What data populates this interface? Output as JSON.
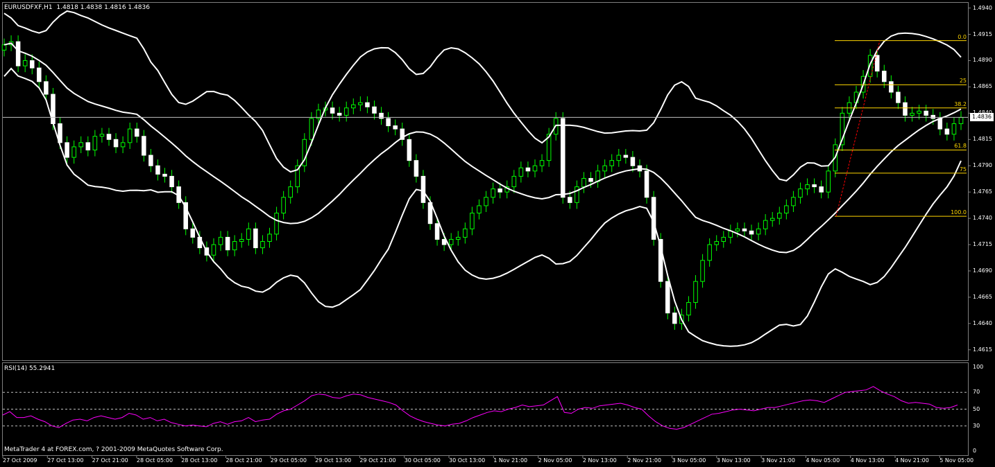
{
  "chart_header": {
    "symbol": "EURUSDFXF,H1",
    "ohlc": "1.4818 1.4838 1.4816 1.4836"
  },
  "copyright": "MetaTrader 4 at FOREX.com, ? 2001-2009 MetaQuotes Software Corp.",
  "current_price": "1.4836",
  "rsi_caption": "RSI(14) 55.2941",
  "colors": {
    "background": "#000000",
    "bull_candle": "#ffffff",
    "bear_candle": "#ffffff",
    "wick": "#00ff00",
    "bollinger": "#ffffff",
    "fib_levels": "#ffd700",
    "fib_trend": "#ff0000",
    "rsi": "#ff00ff",
    "grid_frame": "#808080"
  },
  "fibonacci": {
    "levels": [
      {
        "label": "0.0",
        "price": 1.4909
      },
      {
        "label": "25",
        "price": 1.4867
      },
      {
        "label": "38.2",
        "price": 1.4845
      },
      {
        "label": "61.8",
        "price": 1.4805
      },
      {
        "label": "75",
        "price": 1.4783
      },
      {
        "label": "100.0",
        "price": 1.4742
      }
    ]
  },
  "chart_data": {
    "type": "line",
    "title": "EURUSDFXF,H1",
    "price_axis": {
      "ticks": [
        "1.4940",
        "1.4915",
        "1.4890",
        "1.4865",
        "1.4840",
        "1.4815",
        "1.4790",
        "1.4765",
        "1.4740",
        "1.4715",
        "1.4690",
        "1.4665",
        "1.4640",
        "1.4615"
      ],
      "ylim": [
        1.4605,
        1.4945
      ]
    },
    "time_axis": {
      "ticks": [
        "27 Oct 2009",
        "27 Oct 13:00",
        "27 Oct 21:00",
        "28 Oct 05:00",
        "28 Oct 13:00",
        "28 Oct 21:00",
        "29 Oct 05:00",
        "29 Oct 13:00",
        "29 Oct 21:00",
        "30 Oct 05:00",
        "30 Oct 13:00",
        "1 Nov 21:00",
        "2 Nov 05:00",
        "2 Nov 13:00",
        "2 Nov 21:00",
        "3 Nov 05:00",
        "3 Nov 13:00",
        "3 Nov 21:00",
        "4 Nov 05:00",
        "4 Nov 13:00",
        "4 Nov 21:00",
        "5 Nov 05:00"
      ]
    },
    "close_prices": [
      1.4905,
      1.4908,
      1.4885,
      1.489,
      1.4883,
      1.487,
      1.4858,
      1.483,
      1.4812,
      1.4798,
      1.4808,
      1.4812,
      1.4805,
      1.4818,
      1.482,
      1.4815,
      1.4808,
      1.4812,
      1.4825,
      1.4818,
      1.48,
      1.479,
      1.4782,
      1.478,
      1.477,
      1.4755,
      1.473,
      1.4722,
      1.4712,
      1.4705,
      1.4715,
      1.4722,
      1.471,
      1.4718,
      1.472,
      1.473,
      1.4712,
      1.4718,
      1.4725,
      1.4745,
      1.476,
      1.477,
      1.479,
      1.4815,
      1.4835,
      1.4843,
      1.4845,
      1.484,
      1.4838,
      1.4845,
      1.4848,
      1.485,
      1.4846,
      1.484,
      1.4835,
      1.4828,
      1.4825,
      1.4815,
      1.4795,
      1.478,
      1.4755,
      1.4735,
      1.472,
      1.4715,
      1.472,
      1.4722,
      1.473,
      1.4745,
      1.4752,
      1.476,
      1.4768,
      1.4765,
      1.477,
      1.478,
      1.4788,
      1.4785,
      1.479,
      1.4795,
      1.482,
      1.4835,
      1.476,
      1.4755,
      1.477,
      1.4778,
      1.4775,
      1.4785,
      1.479,
      1.4795,
      1.48,
      1.4798,
      1.479,
      1.4785,
      1.476,
      1.472,
      1.468,
      1.465,
      1.464,
      1.4648,
      1.466,
      1.468,
      1.47,
      1.4715,
      1.4718,
      1.4722,
      1.4728,
      1.473,
      1.4728,
      1.4725,
      1.473,
      1.4738,
      1.474,
      1.4745,
      1.4752,
      1.476,
      1.4768,
      1.4772,
      1.477,
      1.4765,
      1.4785,
      1.481,
      1.484,
      1.485,
      1.486,
      1.4875,
      1.4895,
      1.488,
      1.487,
      1.486,
      1.485,
      1.4838,
      1.484,
      1.4842,
      1.4838,
      1.4835,
      1.4825,
      1.482,
      1.483,
      1.4836
    ],
    "bollinger": {
      "period": 20,
      "upper_series_name": "",
      "middle_series_name": "",
      "lower_series_name": ""
    },
    "rsi": {
      "name": "RSI(14)",
      "last_value": 55.2941,
      "ylim": [
        0,
        100
      ],
      "levels": [
        30,
        50,
        70
      ],
      "ticks": [
        "100",
        "70",
        "50",
        "30",
        "0"
      ],
      "values": [
        43,
        47,
        40,
        40,
        42,
        38,
        35,
        30,
        28,
        33,
        37,
        38,
        36,
        40,
        42,
        40,
        38,
        40,
        45,
        43,
        38,
        40,
        36,
        38,
        34,
        32,
        30,
        31,
        30,
        29,
        33,
        35,
        32,
        35,
        36,
        40,
        35,
        37,
        38,
        44,
        48,
        50,
        55,
        60,
        66,
        68,
        67,
        64,
        63,
        66,
        68,
        67,
        64,
        62,
        60,
        58,
        55,
        48,
        42,
        38,
        35,
        33,
        31,
        30,
        32,
        33,
        36,
        40,
        43,
        46,
        48,
        47,
        50,
        52,
        55,
        53,
        54,
        55,
        60,
        65,
        46,
        45,
        50,
        52,
        51,
        54,
        55,
        56,
        57,
        55,
        52,
        50,
        42,
        35,
        30,
        27,
        26,
        28,
        32,
        36,
        40,
        44,
        45,
        47,
        49,
        50,
        49,
        48,
        50,
        52,
        52,
        54,
        56,
        58,
        60,
        61,
        60,
        58,
        62,
        66,
        70,
        71,
        72,
        73,
        77,
        72,
        68,
        65,
        60,
        57,
        58,
        57,
        56,
        52,
        51,
        52,
        55
      ]
    }
  }
}
